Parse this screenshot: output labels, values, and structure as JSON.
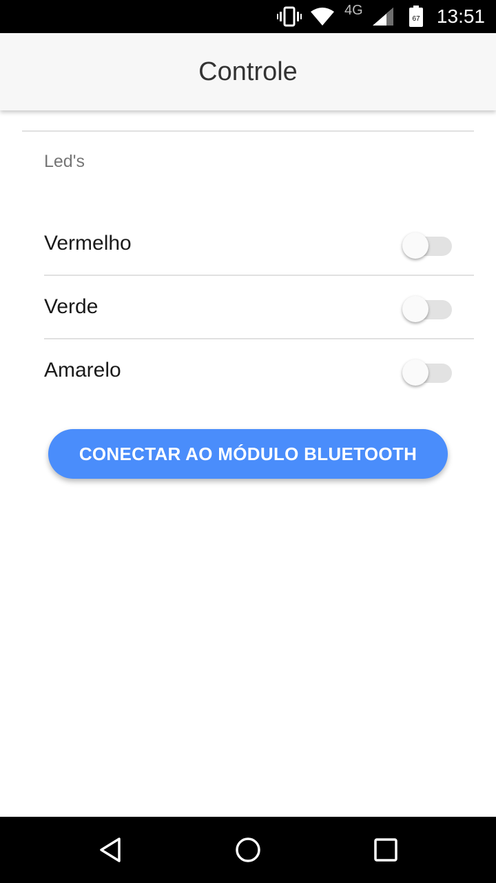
{
  "status_bar": {
    "time": "13:51",
    "network": "4G",
    "battery_level": "67",
    "icons": [
      "vibrate-icon",
      "wifi-icon",
      "signal-icon",
      "battery-icon"
    ]
  },
  "app_bar": {
    "title": "Controle"
  },
  "section": {
    "header": "Led's"
  },
  "leds": [
    {
      "label": "Vermelho",
      "on": false
    },
    {
      "label": "Verde",
      "on": false
    },
    {
      "label": "Amarelo",
      "on": false
    }
  ],
  "connect_button": {
    "label": "CONECTAR AO MÓDULO BLUETOOTH",
    "color": "#4a8dfb"
  },
  "nav_bar": {
    "icons": [
      "back-icon",
      "home-icon",
      "recents-icon"
    ]
  }
}
